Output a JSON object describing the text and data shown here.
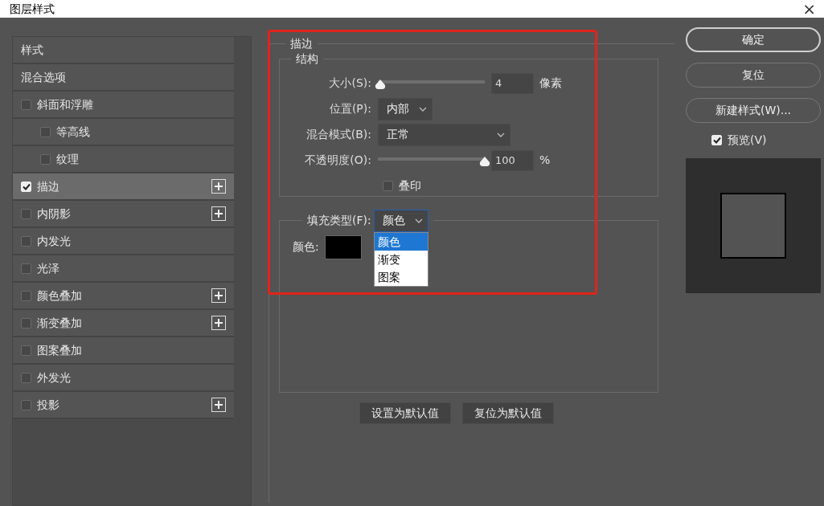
{
  "window": {
    "title": "图层样式",
    "close": "×"
  },
  "sidebar": {
    "items": [
      {
        "label": "样式",
        "kind": "header",
        "selected": false
      },
      {
        "label": "混合选项",
        "kind": "header",
        "selected": false
      },
      {
        "label": "斜面和浮雕",
        "kind": "effect",
        "checked": false,
        "selected": false,
        "add": false,
        "children": [
          {
            "label": "等高线",
            "kind": "effect",
            "checked": false,
            "selected": false,
            "add": false
          },
          {
            "label": "纹理",
            "kind": "effect",
            "checked": false,
            "selected": false,
            "add": false
          }
        ]
      },
      {
        "label": "描边",
        "kind": "effect",
        "checked": true,
        "selected": true,
        "add": true
      },
      {
        "label": "内阴影",
        "kind": "effect",
        "checked": false,
        "selected": false,
        "add": true
      },
      {
        "label": "内发光",
        "kind": "effect",
        "checked": false,
        "selected": false,
        "add": false
      },
      {
        "label": "光泽",
        "kind": "effect",
        "checked": false,
        "selected": false,
        "add": false
      },
      {
        "label": "颜色叠加",
        "kind": "effect",
        "checked": false,
        "selected": false,
        "add": true
      },
      {
        "label": "渐变叠加",
        "kind": "effect",
        "checked": false,
        "selected": false,
        "add": true
      },
      {
        "label": "图案叠加",
        "kind": "effect",
        "checked": false,
        "selected": false,
        "add": false
      },
      {
        "label": "外发光",
        "kind": "effect",
        "checked": false,
        "selected": false,
        "add": false
      },
      {
        "label": "投影",
        "kind": "effect",
        "checked": false,
        "selected": false,
        "add": true
      }
    ]
  },
  "stroke": {
    "title": "描边",
    "structure": {
      "title": "结构",
      "size": {
        "label": "大小(S):",
        "level": 0.02,
        "value": "4",
        "unit": "像素"
      },
      "position": {
        "label": "位置(P):",
        "value": "内部"
      },
      "blend_mode": {
        "label": "混合模式(B):",
        "value": "正常"
      },
      "opacity": {
        "label": "不透明度(O):",
        "level": 1,
        "value": "100",
        "unit": "%"
      },
      "overprint": {
        "label": "叠印",
        "checked": false
      }
    },
    "fill": {
      "label": "填充类型(F):",
      "value": "颜色",
      "expanded": true,
      "options": [
        {
          "label": "颜色",
          "selected": true
        },
        {
          "label": "渐变",
          "selected": false
        },
        {
          "label": "图案",
          "selected": false
        }
      ],
      "color_label": "颜色:",
      "color": "#000000"
    },
    "buttons": [
      "设置为默认值",
      "复位为默认值"
    ]
  },
  "actions": {
    "buttons": [
      {
        "label": "确定",
        "default": true
      },
      {
        "label": "复位",
        "default": false
      },
      {
        "label": "新建样式(W)...",
        "default": false
      }
    ],
    "preview": {
      "label": "预览(V)",
      "checked": true
    }
  }
}
